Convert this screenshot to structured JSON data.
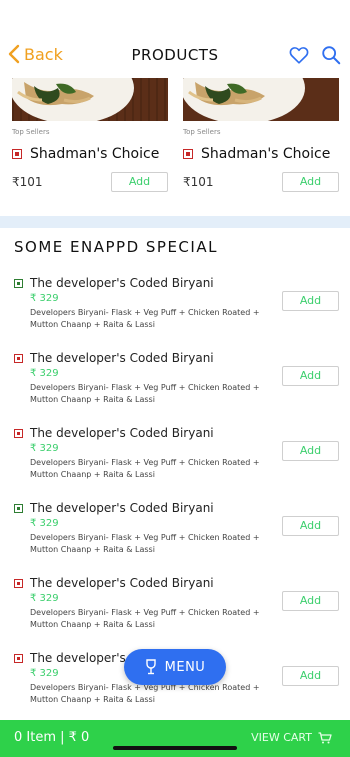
{
  "header": {
    "back_label": "Back",
    "title": "PRODUCTS"
  },
  "cards": [
    {
      "tag": "Top Sellers",
      "name": "Shadman's Choice",
      "price": "₹101",
      "add_label": "Add"
    },
    {
      "tag": "Top Sellers",
      "name": "Shadman's Choice",
      "price": "₹101",
      "add_label": "Add"
    }
  ],
  "section": {
    "title": "SOME ENAPPD SPECIAL"
  },
  "items": [
    {
      "veg": "green",
      "name": "The developer's Coded Biryani",
      "price": "₹ 329",
      "desc": "Developers Biryani- Flask + Veg Puff + Chicken Roated + Mutton Chaanp + Raita & Lassi",
      "add_label": "Add"
    },
    {
      "veg": "red",
      "name": "The developer's Coded Biryani",
      "price": "₹ 329",
      "desc": "Developers Biryani- Flask + Veg Puff + Chicken Roated + Mutton Chaanp + Raita & Lassi",
      "add_label": "Add"
    },
    {
      "veg": "red",
      "name": "The developer's Coded Biryani",
      "price": "₹ 329",
      "desc": "Developers Biryani- Flask + Veg Puff + Chicken Roated + Mutton Chaanp + Raita & Lassi",
      "add_label": "Add"
    },
    {
      "veg": "green",
      "name": "The developer's Coded Biryani",
      "price": "₹ 329",
      "desc": "Developers Biryani- Flask + Veg Puff + Chicken Roated + Mutton Chaanp + Raita & Lassi",
      "add_label": "Add"
    },
    {
      "veg": "red",
      "name": "The developer's Coded Biryani",
      "price": "₹ 329",
      "desc": "Developers Biryani- Flask + Veg Puff + Chicken Roated + Mutton Chaanp + Raita & Lassi",
      "add_label": "Add"
    },
    {
      "veg": "red",
      "name": "The developer's Coded Biryani",
      "price": "₹ 329",
      "desc": "Developers Biryani- Flask + Veg Puff + Chicken Roated + Mutton Chaanp + Raita & Lassi",
      "add_label": "Add"
    }
  ],
  "menu_fab": {
    "label": "MENU"
  },
  "cart_bar": {
    "summary": "0 Item | ₹ 0",
    "view_label": "VIEW CART"
  },
  "colors": {
    "accent_back": "#f0a020",
    "icon_blue": "#2f6ff0",
    "price_green": "#3ccf6d",
    "cart_green": "#2ed14a",
    "band": "#e3eef9"
  },
  "icons": [
    "chevron-left-icon",
    "heart-icon",
    "search-icon",
    "wine-glass-icon",
    "cart-icon"
  ]
}
